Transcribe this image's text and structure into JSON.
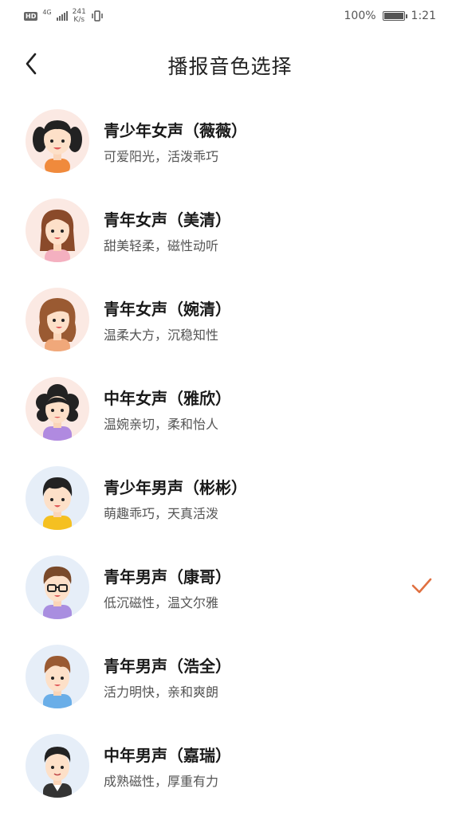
{
  "status_bar": {
    "hd": "HD",
    "network": "4G",
    "speed_value": "241",
    "speed_unit": "K/s",
    "battery": "100%",
    "time": "1:21"
  },
  "header": {
    "title": "播报音色选择"
  },
  "voices": [
    {
      "name": "青少年女声（薇薇）",
      "desc": "可爱阳光，活泼乖巧",
      "avatar": "teen-girl-avatar",
      "selected": false
    },
    {
      "name": "青年女声（美清）",
      "desc": "甜美轻柔，磁性动听",
      "avatar": "young-woman-avatar",
      "selected": false
    },
    {
      "name": "青年女声（婉清）",
      "desc": "温柔大方，沉稳知性",
      "avatar": "young-woman-wavy-avatar",
      "selected": false
    },
    {
      "name": "中年女声（雅欣）",
      "desc": "温婉亲切，柔和怡人",
      "avatar": "middle-aged-woman-avatar",
      "selected": false
    },
    {
      "name": "青少年男声（彬彬）",
      "desc": "萌趣乖巧，天真活泼",
      "avatar": "teen-boy-avatar",
      "selected": false
    },
    {
      "name": "青年男声（康哥）",
      "desc": "低沉磁性，温文尔雅",
      "avatar": "young-man-glasses-avatar",
      "selected": true
    },
    {
      "name": "青年男声（浩全）",
      "desc": "活力明快，亲和爽朗",
      "avatar": "young-man-avatar",
      "selected": false
    },
    {
      "name": "中年男声（嘉瑞）",
      "desc": "成熟磁性，厚重有力",
      "avatar": "middle-aged-man-avatar",
      "selected": false
    }
  ],
  "colors": {
    "accent_check": "#e07040",
    "female_avatar_bg": "#fbe9e3",
    "male_avatar_bg": "#e6eef8"
  }
}
